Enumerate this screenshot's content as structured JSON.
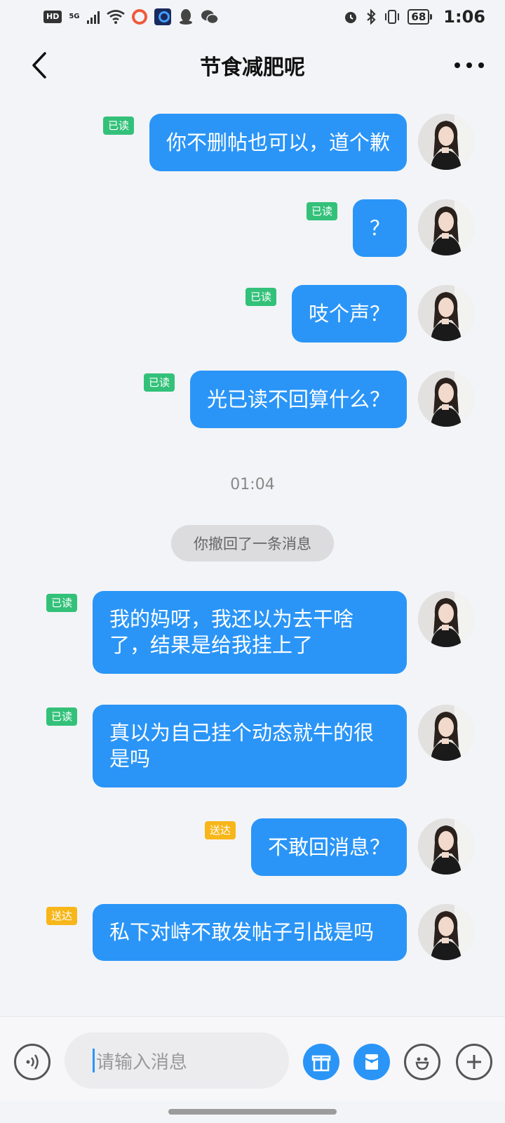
{
  "status_bar": {
    "hd": "HD",
    "network": "5G",
    "battery": "68",
    "time": "1:06"
  },
  "header": {
    "title": "节食减肥呢"
  },
  "messages_before": [
    {
      "text": "你不删帖也可以，道个歉",
      "status": "已读"
    },
    {
      "text": "？",
      "status": "已读"
    },
    {
      "text": "吱个声？",
      "status": "已读"
    },
    {
      "text": "光已读不回算什么？",
      "status": "已读"
    }
  ],
  "timestamp": "01:04",
  "recall_notice": "你撤回了一条消息",
  "messages_after": [
    {
      "text": "我的妈呀，我还以为去干啥了，结果是给我挂上了",
      "status": "已读"
    },
    {
      "text": "真以为自己挂个动态就牛的很是吗",
      "status": "已读"
    },
    {
      "text": "不敢回消息？",
      "status": "送达"
    },
    {
      "text": "私下对峙不敢发帖子引战是吗",
      "status": "送达"
    }
  ],
  "input": {
    "placeholder": "请输入消息"
  },
  "colors": {
    "bubble": "#2a95f7",
    "read_badge": "#33c17a",
    "sent_badge": "#f7b619"
  }
}
